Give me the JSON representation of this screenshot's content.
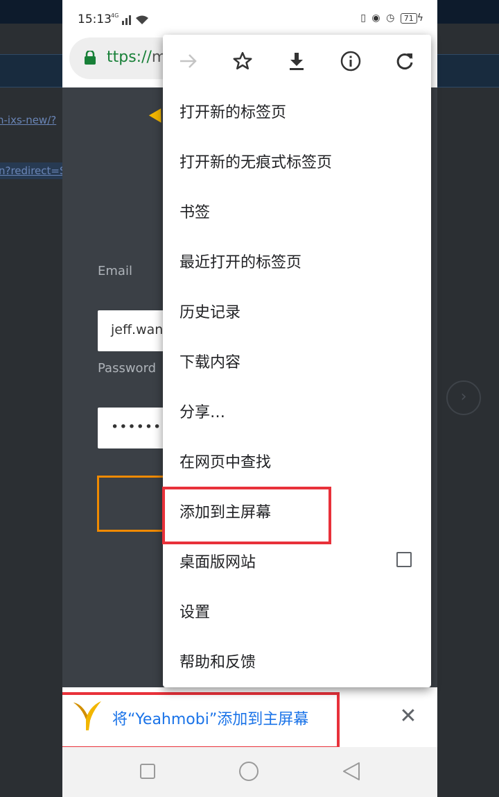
{
  "status_bar": {
    "time": "15:13",
    "network": "4G",
    "battery": "71"
  },
  "browser": {
    "url_visible": "ttps://",
    "url_rest": "m"
  },
  "background_page": {
    "link1": "n-ixs-new/?",
    "link2": "n?redirect=S"
  },
  "login_form": {
    "email_label": "Email",
    "email_value": "jeff.wan",
    "password_label": "Password",
    "password_value": "••••••••"
  },
  "menu": {
    "icons": [
      "forward-icon",
      "star-icon",
      "download-icon",
      "info-icon",
      "refresh-icon"
    ],
    "items": [
      {
        "label": "打开新的标签页"
      },
      {
        "label": "打开新的无痕式标签页"
      },
      {
        "label": "书签"
      },
      {
        "label": "最近打开的标签页"
      },
      {
        "label": "历史记录"
      },
      {
        "label": "下载内容"
      },
      {
        "label": "分享…"
      },
      {
        "label": "在网页中查找"
      },
      {
        "label": "添加到主屏幕"
      },
      {
        "label": "桌面版网站"
      },
      {
        "label": "设置"
      },
      {
        "label": "帮助和反馈"
      }
    ]
  },
  "add_to_home_bar": {
    "text": "将“Yeahmobi”添加到主屏幕"
  },
  "colors": {
    "highlight": "#e8313a",
    "link_blue": "#1a73e8",
    "secure_green": "#188038",
    "orange_accent": "#f08a00",
    "logo_yellow": "#f2b600"
  }
}
